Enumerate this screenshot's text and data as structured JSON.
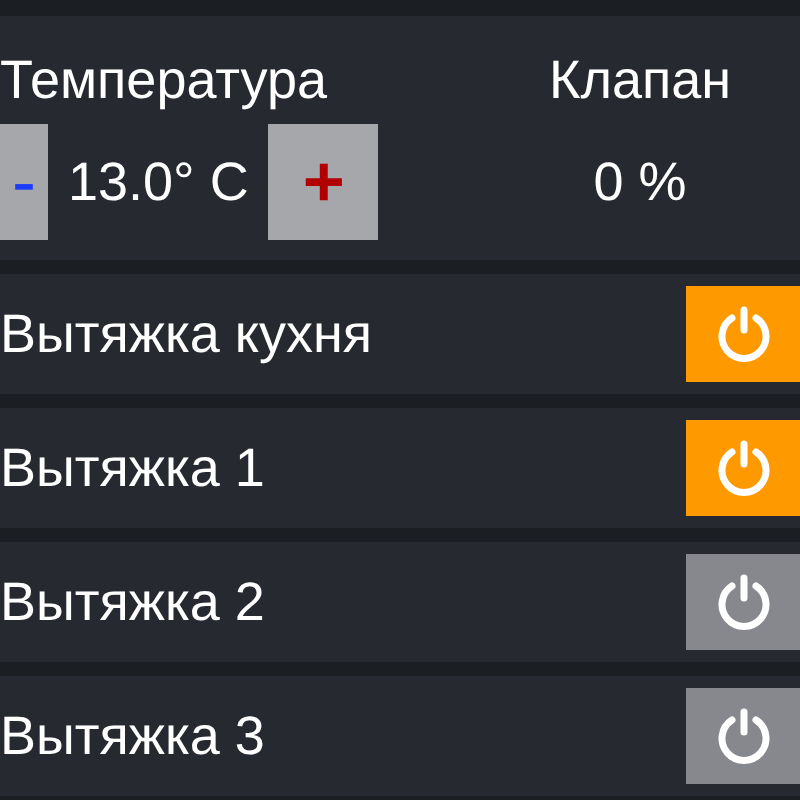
{
  "temperature": {
    "label": "Температура",
    "value": "13.0° C",
    "decrease": "-",
    "increase": "+"
  },
  "valve": {
    "label": "Клапан",
    "value": "0 %"
  },
  "fans": [
    {
      "label": "Вытяжка кухня",
      "on": true
    },
    {
      "label": "Вытяжка 1",
      "on": true
    },
    {
      "label": "Вытяжка 2",
      "on": false
    },
    {
      "label": "Вытяжка 3",
      "on": false
    }
  ]
}
